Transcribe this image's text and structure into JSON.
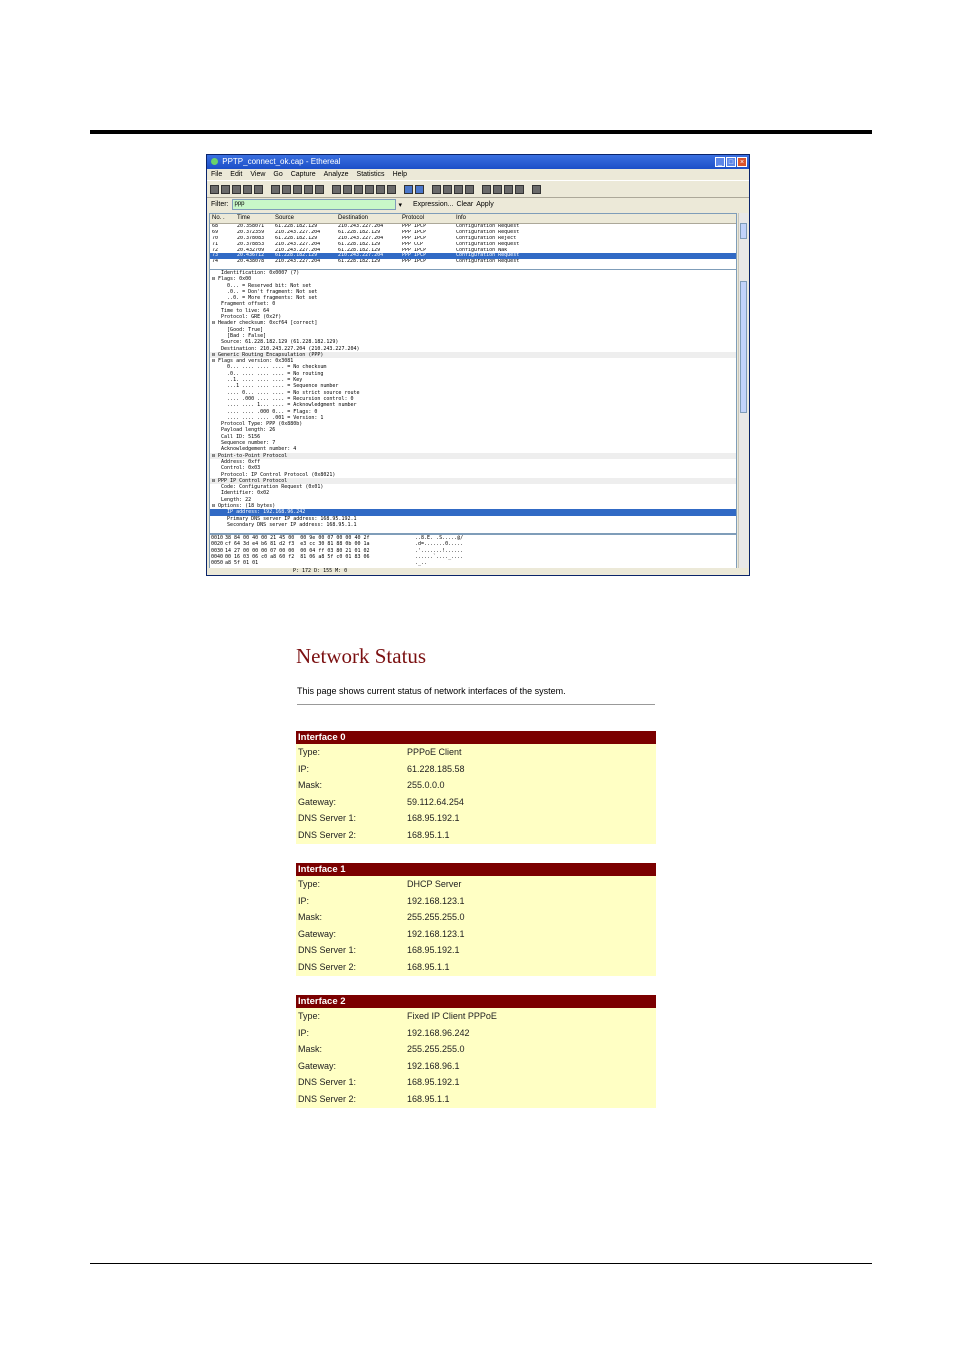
{
  "window": {
    "title": "PPTP_connect_ok.cap - Ethereal",
    "menu": [
      "File",
      "Edit",
      "View",
      "Go",
      "Capture",
      "Analyze",
      "Statistics",
      "Help"
    ],
    "filter": {
      "label": "Filter:",
      "value": "ррр",
      "expression": "Expression...",
      "clear": "Clear",
      "apply": "Apply"
    },
    "list_columns": [
      "No. .",
      "Time",
      "Source",
      "Destination",
      "Protocol",
      "Info"
    ],
    "packets": [
      [
        "68",
        "20.358071",
        "61.228.182.129",
        "210.243.227.204",
        "PPP IPCP",
        "Configuration Request"
      ],
      [
        "69",
        "20.372359",
        "210.243.227.204",
        "61.228.182.129",
        "PPP IPCP",
        "Configuration Request"
      ],
      [
        "70",
        "20.378083",
        "61.228.182.129",
        "210.243.227.204",
        "PPP IPCP",
        "Configuration Reject"
      ],
      [
        "71",
        "20.378853",
        "210.243.227.204",
        "61.228.182.129",
        "PPP CCP",
        "Configuration Request"
      ],
      [
        "72",
        "20.432709",
        "210.243.227.204",
        "61.228.182.129",
        "PPP IPCP",
        "Configuration Nak"
      ],
      [
        "73",
        "20.436712",
        "61.228.182.129",
        "210.243.227.204",
        "PPP IPCP",
        "Configuration Request"
      ],
      [
        "74",
        "20.438078",
        "210.243.227.204",
        "61.228.182.129",
        "PPP IPCP",
        "Configuration Request"
      ]
    ],
    "selected_packet_index": 5,
    "tree": [
      "   Identification: 0x0007 (7)",
      "⊟ Flags: 0x00",
      "     0... = Reserved bit: Not set",
      "     .0.. = Don't fragment: Not set",
      "     ..0. = More fragments: Not set",
      "   Fragment offset: 0",
      "   Time to live: 64",
      "   Protocol: GRE (0x2f)",
      "⊟ Header checksum: 0xcf64 [correct]",
      "     [Good: True]",
      "     [Bad : False]",
      "   Source: 61.228.182.129 (61.228.182.129)",
      "   Destination: 210.243.227.204 (210.243.227.204)",
      "⊟ Generic Routing Encapsulation (PPP)",
      "⊟ Flags and version: 0x3081",
      "     0... .... .... .... = No checksum",
      "     .0.. .... .... .... = No routing",
      "     ..1. .... .... .... = Key",
      "     ...1 .... .... .... = Sequence number",
      "     .... 0... .... .... = No strict source route",
      "     .... .000 .... .... = Recursion control: 0",
      "     .... .... 1... .... = Acknowledgment number",
      "     .... .... .000 0... = Flags: 0",
      "     .... .... .... .001 = Version: 1",
      "   Protocol Type: PPP (0x880b)",
      "   Payload length: 26",
      "   Call ID: 5156",
      "   Sequence number: 7",
      "   Acknowledgement number: 4",
      "⊟ Point-to-Point Protocol",
      "   Address: 0xff",
      "   Control: 0x03",
      "   Protocol: IP Control Protocol (0x8021)",
      "⊟ PPP IP Control Protocol",
      "   Code: Configuration Request (0x01)",
      "   Identifier: 0x02",
      "   Length: 22",
      "⊟ Options: (18 bytes)",
      "     IP address: 192.168.96.242",
      "     Primary DNS server IP address: 168.95.192.1",
      "     Secondary DNS server IP address: 168.95.1.1"
    ],
    "tree_selected_index": 38,
    "tree_section_indices": [
      13,
      29,
      33
    ],
    "hex": [
      [
        "0010",
        "38 84 00 40 00 21 45 00  00 9e 00 07 00 00 40 2f",
        "..8.E. .S.....@/"
      ],
      [
        "0020",
        "cf 64 3d e4 b6 81 d2 f3  e3 cc 30 81 88 0b 00 1a",
        ".d=.......0....."
      ],
      [
        "0030",
        "14 27 00 00 00 07 00 00  00 04 ff 03 80 21 01 02",
        ".'.......!......"
      ],
      [
        "0040",
        "00 16 03 06 c0 a8 60 f2  81 06 a8 5f c0 01 83 06",
        "......`...._...."
      ],
      [
        "0050",
        "a8 5f 01 01",
        "._.."
      ]
    ],
    "status": "P: 172 D: 155 M: 0"
  },
  "network_status": {
    "title": "Network Status",
    "description": "This page shows current status of network interfaces of the system.",
    "interfaces": [
      {
        "name": "Interface 0",
        "rows": [
          {
            "label": "Type:",
            "value": "PPPoE Client"
          },
          {
            "label": "IP:",
            "value": "61.228.185.58"
          },
          {
            "label": "Mask:",
            "value": "255.0.0.0"
          },
          {
            "label": "Gateway:",
            "value": "59.112.64.254"
          },
          {
            "label": "DNS Server 1:",
            "value": "168.95.192.1"
          },
          {
            "label": "DNS Server 2:",
            "value": "168.95.1.1"
          }
        ]
      },
      {
        "name": "Interface 1",
        "rows": [
          {
            "label": "Type:",
            "value": "DHCP Server"
          },
          {
            "label": "IP:",
            "value": "192.168.123.1"
          },
          {
            "label": "Mask:",
            "value": "255.255.255.0"
          },
          {
            "label": "Gateway:",
            "value": "192.168.123.1"
          },
          {
            "label": "DNS Server 1:",
            "value": "168.95.192.1"
          },
          {
            "label": "DNS Server 2:",
            "value": "168.95.1.1"
          }
        ]
      },
      {
        "name": "Interface 2",
        "rows": [
          {
            "label": "Type:",
            "value": "Fixed IP Client PPPoE"
          },
          {
            "label": "IP:",
            "value": "192.168.96.242"
          },
          {
            "label": "Mask:",
            "value": "255.255.255.0"
          },
          {
            "label": "Gateway:",
            "value": "192.168.96.1"
          },
          {
            "label": "DNS Server 1:",
            "value": "168.95.192.1"
          },
          {
            "label": "DNS Server 2:",
            "value": "168.95.1.1"
          }
        ]
      }
    ],
    "colors": {
      "header_bg": "#7b0000",
      "row_bg": "#ffffc4",
      "title": "#7b1011"
    }
  }
}
